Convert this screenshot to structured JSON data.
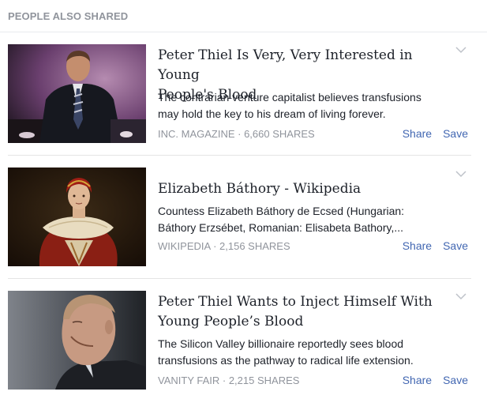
{
  "header": {
    "title": "PEOPLE ALSO SHARED"
  },
  "items": [
    {
      "title_line1": "Peter Thiel Is Very, Very Interested in Young",
      "title_line2": "People's Blood",
      "desc_line1": "The contrarian venture capitalist believes transfusions",
      "desc_line2": "may hold the key to his dream of living forever.",
      "source": "INC. MAGAZINE",
      "shares": "6,660 SHARES",
      "share_label": "Share",
      "save_label": "Save",
      "thumbnail_icon": "person-photo-icon"
    },
    {
      "title_line1": "Elizabeth Báthory - Wikipedia",
      "title_line2": "",
      "desc_line1": "Countess Elizabeth Báthory de Ecsed (Hungarian:",
      "desc_line2": "Báthory Erzsébet, Romanian: Elisabeta Bathory,...",
      "source": "WIKIPEDIA",
      "shares": "2,156 SHARES",
      "share_label": "Share",
      "save_label": "Save",
      "thumbnail_icon": "portrait-painting-icon"
    },
    {
      "title_line1": "Peter Thiel Wants to Inject Himself With",
      "title_line2": "Young People’s Blood",
      "desc_line1": "The Silicon Valley billionaire reportedly sees blood",
      "desc_line2": "transfusions as the pathway to radical life extension.",
      "source": "VANITY FAIR",
      "shares": "2,215 SHARES",
      "share_label": "Share",
      "save_label": "Save",
      "thumbnail_icon": "person-photo-icon"
    }
  ],
  "separator": " · ",
  "colors": {
    "link": "#4267b2",
    "muted": "#90949c",
    "text": "#1d2129"
  }
}
